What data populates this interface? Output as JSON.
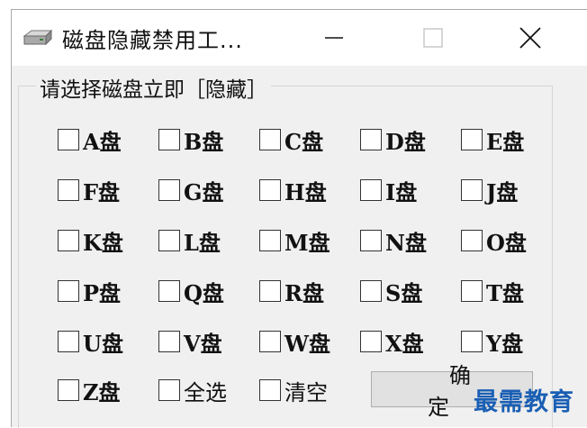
{
  "window": {
    "title": "磁盘隐藏禁用工...",
    "icon": "disk-drive-icon"
  },
  "group": {
    "legend": "请选择磁盘立即［隐藏］"
  },
  "drives": [
    {
      "letter": "A",
      "suffix": "盘",
      "checked": false
    },
    {
      "letter": "B",
      "suffix": "盘",
      "checked": false
    },
    {
      "letter": "C",
      "suffix": "盘",
      "checked": false
    },
    {
      "letter": "D",
      "suffix": "盘",
      "checked": false
    },
    {
      "letter": "E",
      "suffix": "盘",
      "checked": false
    },
    {
      "letter": "F",
      "suffix": "盘",
      "checked": false
    },
    {
      "letter": "G",
      "suffix": "盘",
      "checked": false
    },
    {
      "letter": "H",
      "suffix": "盘",
      "checked": false
    },
    {
      "letter": "I",
      "suffix": "盘",
      "checked": false
    },
    {
      "letter": "J",
      "suffix": "盘",
      "checked": false
    },
    {
      "letter": "K",
      "suffix": "盘",
      "checked": false
    },
    {
      "letter": "L",
      "suffix": "盘",
      "checked": false
    },
    {
      "letter": "M",
      "suffix": "盘",
      "checked": false
    },
    {
      "letter": "N",
      "suffix": "盘",
      "checked": false
    },
    {
      "letter": "O",
      "suffix": "盘",
      "checked": false
    },
    {
      "letter": "P",
      "suffix": "盘",
      "checked": false
    },
    {
      "letter": "Q",
      "suffix": "盘",
      "checked": false
    },
    {
      "letter": "R",
      "suffix": "盘",
      "checked": false
    },
    {
      "letter": "S",
      "suffix": "盘",
      "checked": false
    },
    {
      "letter": "T",
      "suffix": "盘",
      "checked": false
    },
    {
      "letter": "U",
      "suffix": "盘",
      "checked": false
    },
    {
      "letter": "V",
      "suffix": "盘",
      "checked": false
    },
    {
      "letter": "W",
      "suffix": "盘",
      "checked": false
    },
    {
      "letter": "X",
      "suffix": "盘",
      "checked": false
    },
    {
      "letter": "Y",
      "suffix": "盘",
      "checked": false
    },
    {
      "letter": "Z",
      "suffix": "盘",
      "checked": false
    }
  ],
  "options": {
    "select_all": {
      "label": "全选",
      "checked": false
    },
    "clear": {
      "label": "清空",
      "checked": false
    }
  },
  "buttons": {
    "ok_label": "确 定"
  },
  "watermark": {
    "text": "最需教育",
    "color": "#1a5fb4"
  }
}
